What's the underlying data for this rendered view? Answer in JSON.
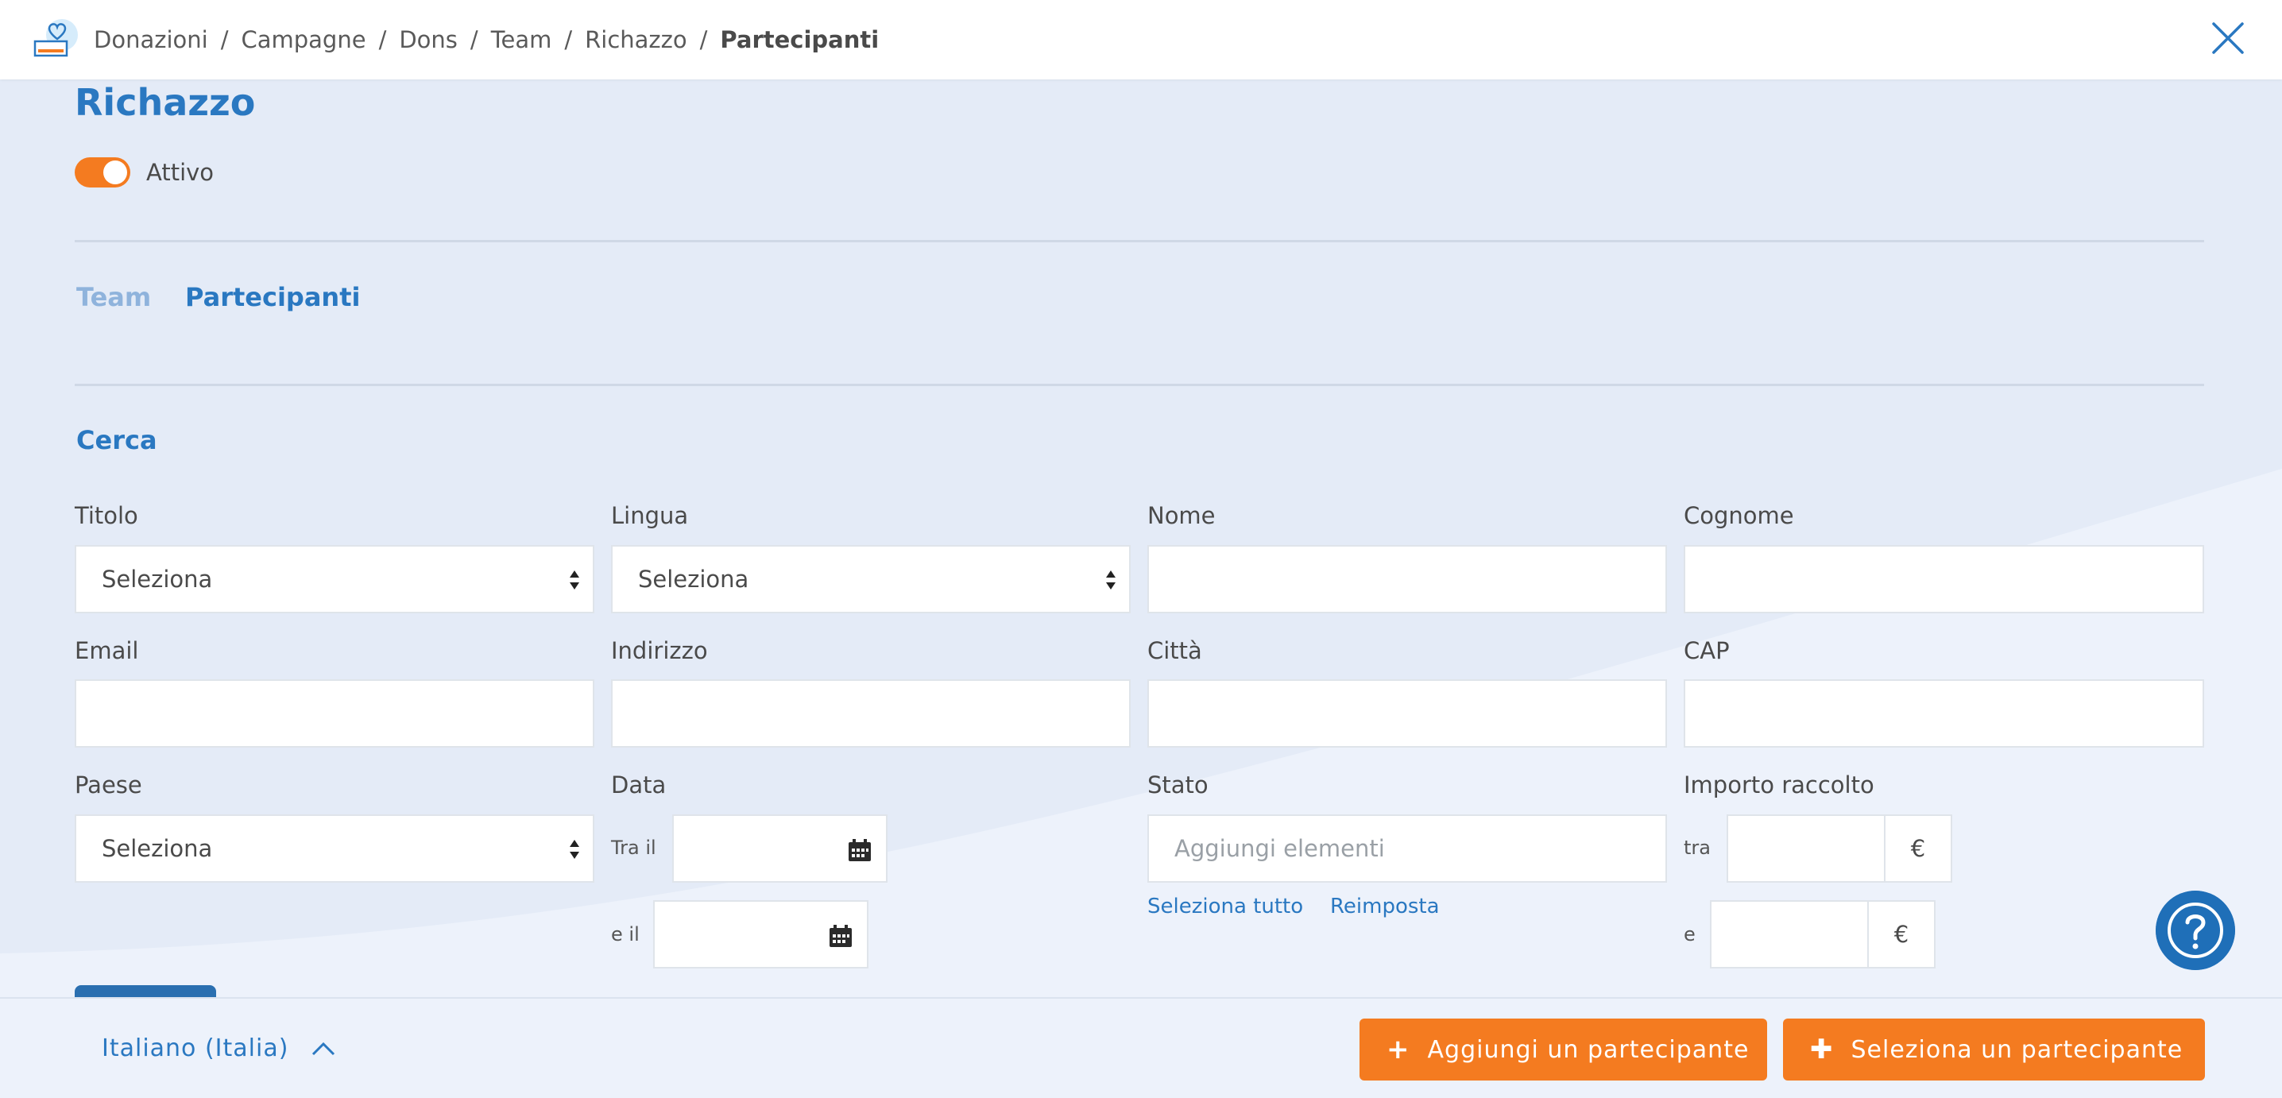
{
  "header": {
    "breadcrumb": [
      "Donazioni",
      "Campagne",
      "Dons",
      "Team",
      "Richazzo",
      "Partecipanti"
    ],
    "separator": "/"
  },
  "page": {
    "title": "Richazzo",
    "toggle": {
      "label": "Attivo",
      "on": true
    }
  },
  "tabs": [
    {
      "label": "Team",
      "active": false
    },
    {
      "label": "Partecipanti",
      "active": true
    }
  ],
  "search": {
    "title": "Cerca",
    "fields": {
      "titolo": {
        "label": "Titolo",
        "value": "Seleziona"
      },
      "lingua": {
        "label": "Lingua",
        "value": "Seleziona"
      },
      "nome": {
        "label": "Nome",
        "value": ""
      },
      "cognome": {
        "label": "Cognome",
        "value": ""
      },
      "email": {
        "label": "Email",
        "value": ""
      },
      "indirizzo": {
        "label": "Indirizzo",
        "value": ""
      },
      "citta": {
        "label": "Città",
        "value": ""
      },
      "cap": {
        "label": "CAP",
        "value": ""
      },
      "paese": {
        "label": "Paese",
        "value": "Seleziona"
      },
      "data": {
        "label": "Data",
        "from_label": "Tra il",
        "to_label": "e il"
      },
      "stato": {
        "label": "Stato",
        "placeholder": "Aggiungi elementi",
        "select_all": "Seleziona tutto",
        "reset": "Reimposta"
      },
      "importo": {
        "label": "Importo raccolto",
        "from_label": "tra",
        "to_label": "e",
        "currency": "€"
      }
    }
  },
  "footer": {
    "language": "Italiano (Italia)",
    "add_button": "Aggiungi un partecipante",
    "select_button": "Seleziona un partecipante"
  },
  "colors": {
    "accent": "#2a78c1",
    "orange": "#f47b20",
    "background": "#e4ebf7"
  }
}
